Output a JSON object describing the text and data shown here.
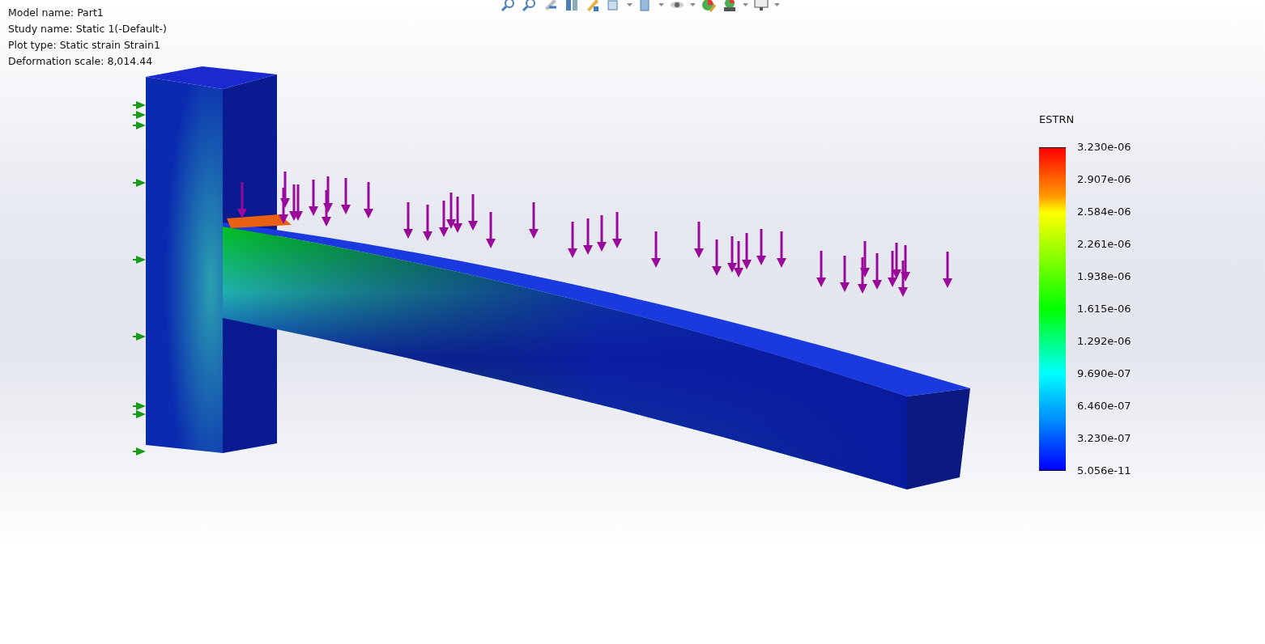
{
  "plot_info": [
    "Model name: Part1",
    "Study name: Static 1(-Default-)",
    "Plot type: Static strain Strain1",
    "Deformation scale: 8,014.44"
  ],
  "legend": {
    "title": "ESTRN",
    "labels": [
      "3.230e-06",
      "2.907e-06",
      "2.584e-06",
      "2.261e-06",
      "1.938e-06",
      "1.615e-06",
      "1.292e-06",
      "9.690e-07",
      "6.460e-07",
      "3.230e-07",
      "5.056e-11"
    ]
  }
}
